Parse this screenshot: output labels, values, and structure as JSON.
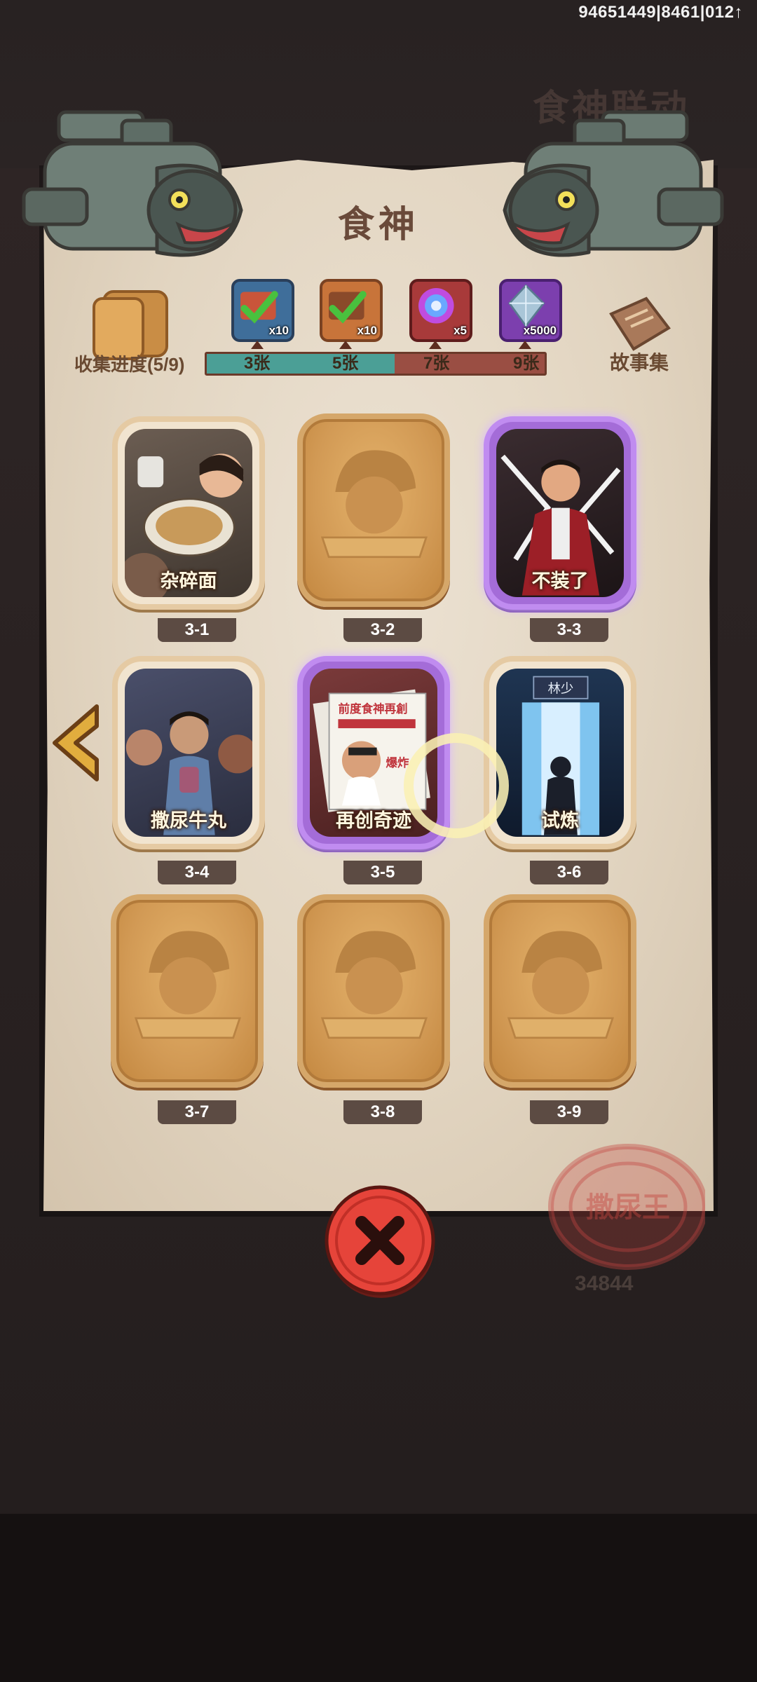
{
  "status_bar": {
    "id_text": "94651449|8461|012↑"
  },
  "background": {
    "faint_title": "食神联动",
    "faint_count": "34844"
  },
  "panel": {
    "title": "食神",
    "collection": {
      "label": "收集进度(5/9)"
    },
    "story": {
      "label": "故事集"
    },
    "rewards": [
      {
        "icon": "green-check-card-icon",
        "count": "x10",
        "threshold": "3张",
        "claimed": true
      },
      {
        "icon": "orange-check-card-icon",
        "count": "x10",
        "threshold": "5张",
        "claimed": true
      },
      {
        "icon": "purple-orb-icon",
        "count": "x5",
        "threshold": "7张",
        "claimed": false
      },
      {
        "icon": "crystal-icon",
        "count": "x5000",
        "threshold": "9张",
        "claimed": false
      }
    ],
    "progress": {
      "collected": 5,
      "total": 9
    }
  },
  "cards": [
    {
      "num": "3-1",
      "name": "杂碎面",
      "state": "common"
    },
    {
      "num": "3-2",
      "name": "",
      "state": "locked"
    },
    {
      "num": "3-3",
      "name": "不装了",
      "state": "epic"
    },
    {
      "num": "3-4",
      "name": "撒尿牛丸",
      "state": "common"
    },
    {
      "num": "3-5",
      "name": "再创奇迹",
      "state": "epic"
    },
    {
      "num": "3-6",
      "name": "试炼",
      "state": "common"
    },
    {
      "num": "3-7",
      "name": "",
      "state": "locked"
    },
    {
      "num": "3-8",
      "name": "",
      "state": "locked"
    },
    {
      "num": "3-9",
      "name": "",
      "state": "locked"
    }
  ],
  "art_text": {
    "door_sign": "林少",
    "news_headline": "前度食神再創",
    "news_tag": "爆炸"
  },
  "stamp_text": "撒尿王",
  "colors": {
    "accent_teal": "#4b9f96",
    "bar_red": "#9a4e43",
    "close_red": "#e6443a",
    "epic_purple": "#b07fe6"
  }
}
